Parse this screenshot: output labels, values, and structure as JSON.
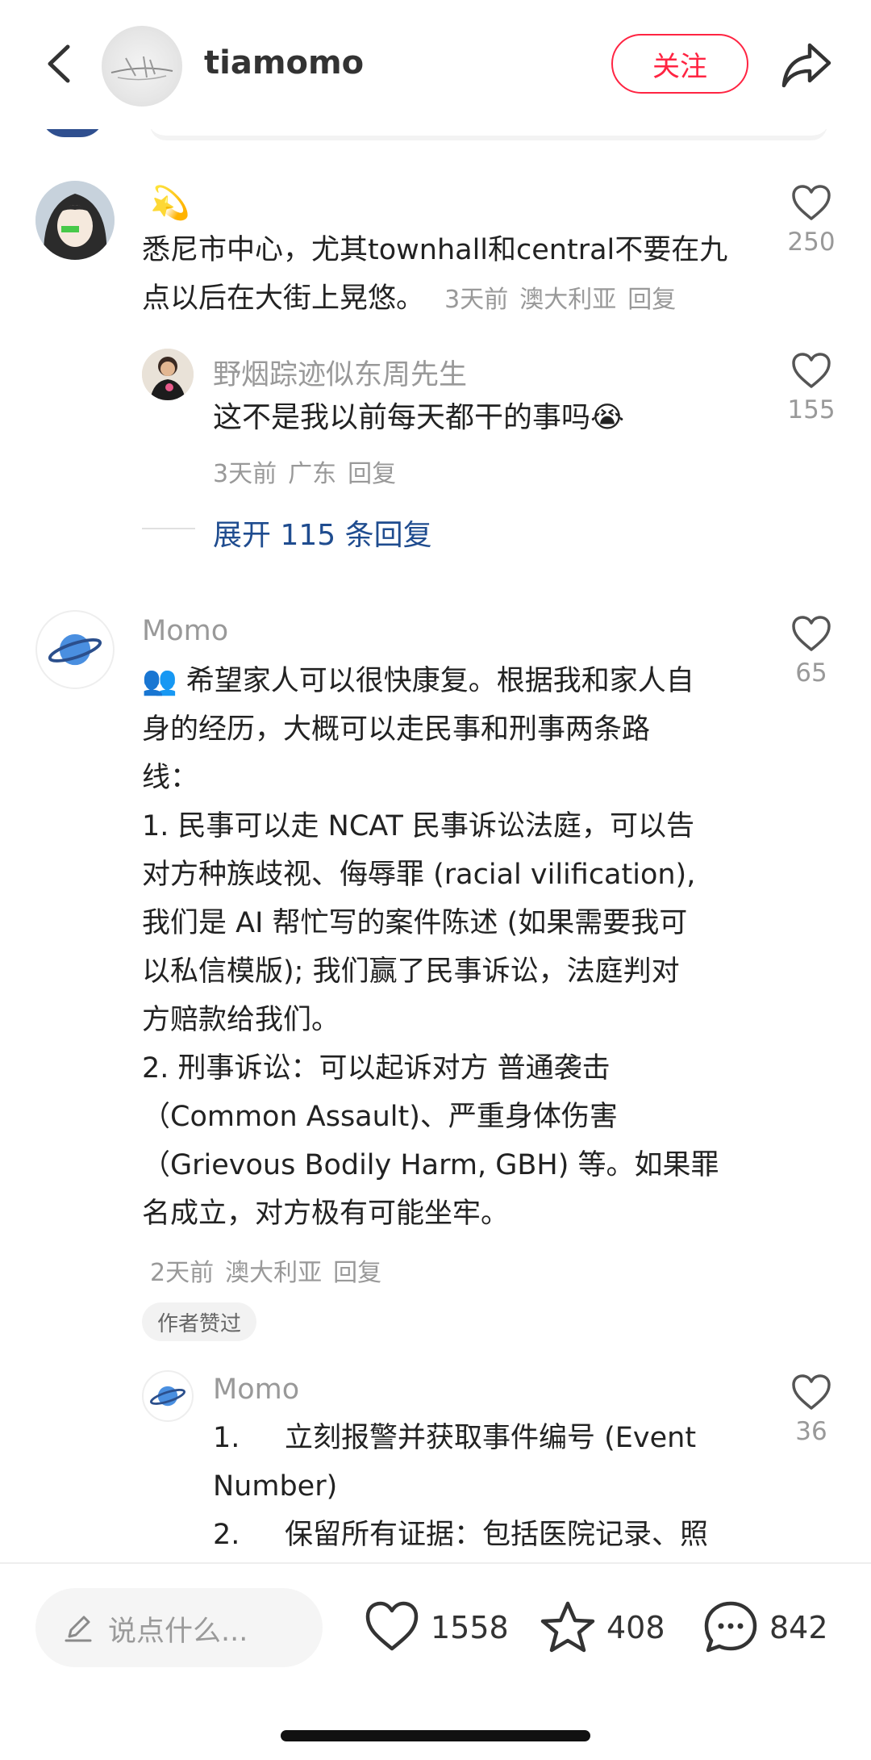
{
  "header": {
    "author": "tiamomo",
    "follow_label": "关注"
  },
  "comments": [
    {
      "emoji": "💫",
      "text": "悉尼市中心，尤其townhall和central不要在九点以后在大街上晃悠。",
      "time": "3天前",
      "location": "澳大利亚",
      "reply": "回复",
      "likes": "250",
      "subreply": {
        "name": "野烟踪迹似东周先生",
        "text": "这不是我以前每天都干的事吗😭",
        "time": "3天前",
        "location": "广东",
        "reply": "回复",
        "likes": "155"
      },
      "expand_label": "展开 115 条回复"
    },
    {
      "name": "Momo",
      "lines": [
        "👥 希望家人可以很快康复。根据我和家人自",
        "身的经历，大概可以走民事和刑事两条路",
        "线：",
        "1. 民事可以走 NCAT 民事诉讼法庭，可以告",
        "对方种族歧视、侮辱罪 (racial vilification),",
        "我们是 AI 帮忙写的案件陈述 (如果需要我可",
        "以私信模版); 我们赢了民事诉讼，法庭判对",
        "方赔款给我们。",
        "2. 刑事诉讼：可以起诉对方 普通袭击",
        "（Common Assault)、严重身体伤害",
        "（Grievous Bodily Harm, GBH) 等。如果罪",
        "名成立，对方极有可能坐牢。"
      ],
      "time": "2天前",
      "location": "澳大利亚",
      "reply": "回复",
      "likes": "65",
      "badge": "作者赞过",
      "subreply": {
        "name": "Momo",
        "lines": [
          "1.     立刻报警并获取事件编号 (Event",
          "Number)",
          "2.     保留所有证据：包括医院记录、照"
        ],
        "likes": "36"
      }
    }
  ],
  "bottom": {
    "placeholder": "说点什么...",
    "likes": "1558",
    "favorites": "408",
    "comments": "842"
  }
}
